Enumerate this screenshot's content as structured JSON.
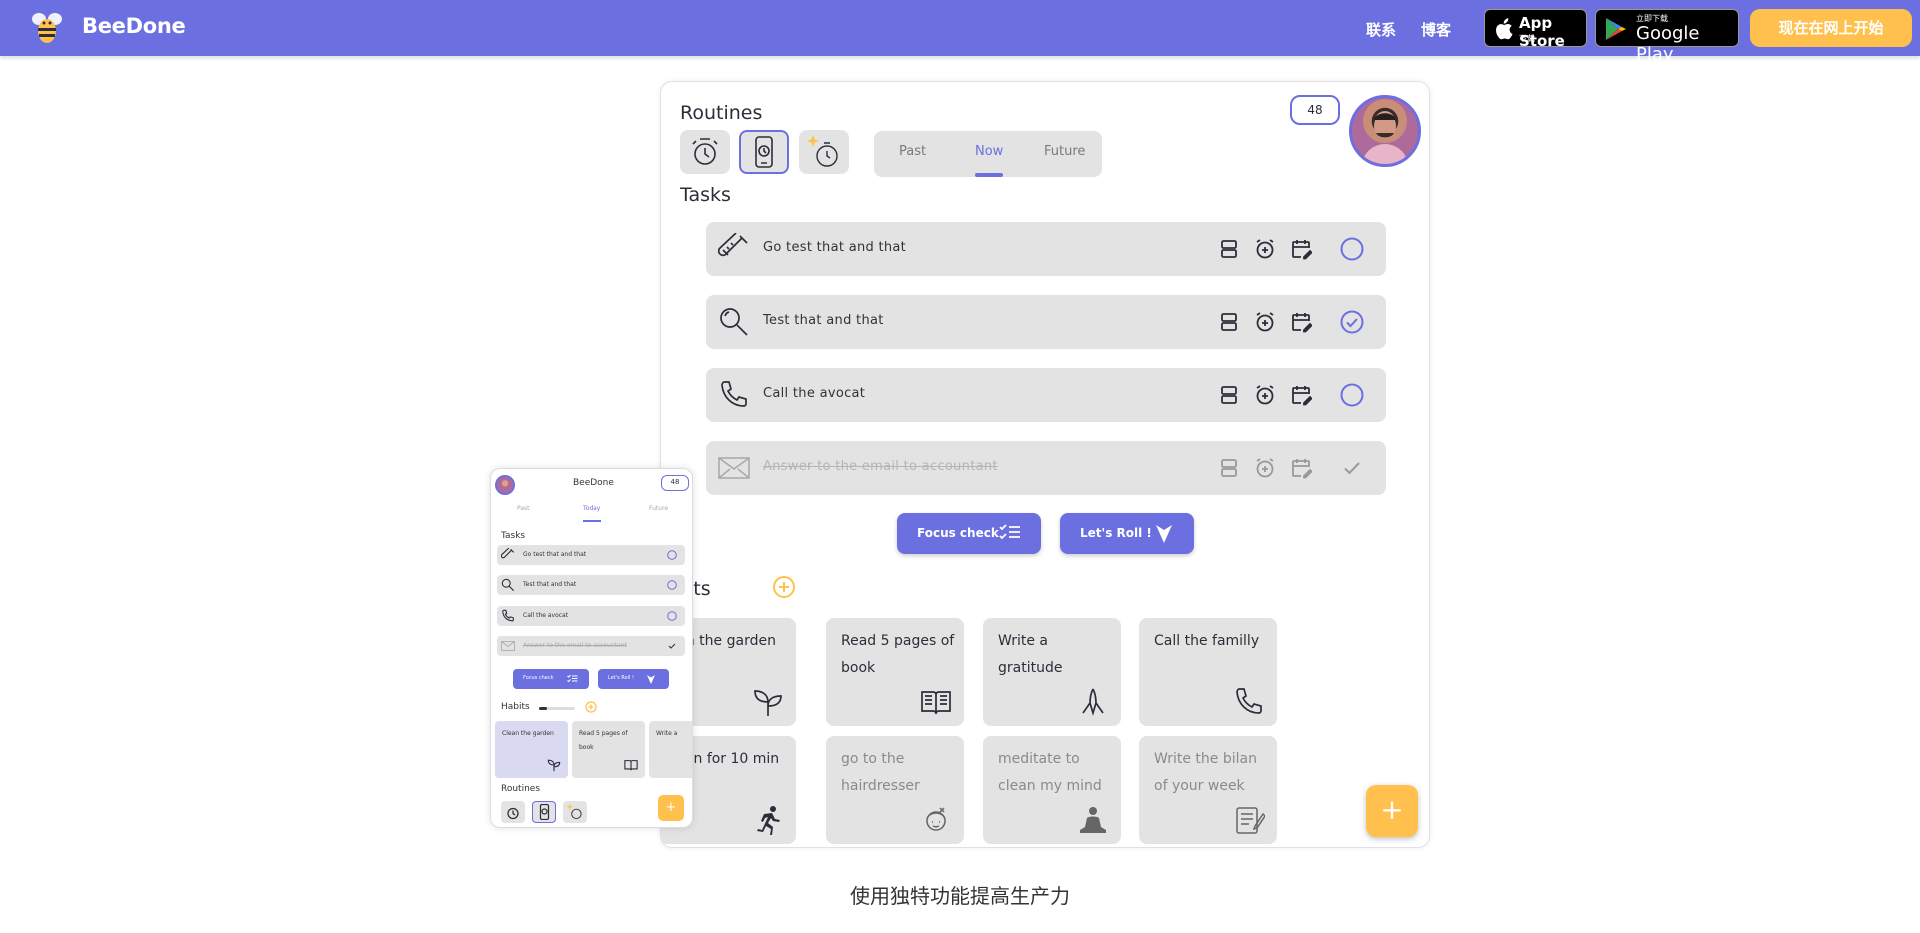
{
  "nav": {
    "brand": "BeeDone",
    "links": [
      "联系",
      "博客"
    ],
    "app_store": {
      "small": "下载",
      "big": "App Store"
    },
    "google_play": {
      "small": "立即下载",
      "big": "Google Play"
    },
    "cta": "现在在网上开始"
  },
  "app": {
    "routines_title": "Routines",
    "segments": [
      "Past",
      "Now",
      "Future"
    ],
    "active_segment": "Now",
    "score": "48",
    "tasks_title": "Tasks",
    "tasks": [
      {
        "label": "Go test that and that",
        "icon": "test-tube-icon",
        "state": "open"
      },
      {
        "label": "Test that and that",
        "icon": "magnifier-icon",
        "state": "checked"
      },
      {
        "label": "Call the avocat",
        "icon": "phone-icon",
        "state": "open"
      },
      {
        "label": "Answer to the email to accountant",
        "icon": "envelope-icon",
        "state": "done"
      }
    ],
    "focus_check": "Focus check",
    "lets_roll": "Let's Roll !",
    "habits_title": "Habits",
    "habits": [
      {
        "label": "Clean the garden",
        "icon": "sprout-icon",
        "muted": false
      },
      {
        "label": "Read 5 pages of book",
        "icon": "book-icon",
        "muted": false
      },
      {
        "label": "Write a gratitude",
        "icon": "praying-hands-icon",
        "muted": false
      },
      {
        "label": "Call the familly",
        "icon": "phone-icon",
        "muted": false
      },
      {
        "label": "Go run for 10 min",
        "icon": "runner-icon",
        "muted": false
      },
      {
        "label": "go to the hairdresser",
        "icon": "hairdresser-icon",
        "muted": true
      },
      {
        "label": "meditate to clean my mind",
        "icon": "meditation-icon",
        "muted": true
      },
      {
        "label": "Write the bilan of your week",
        "icon": "notepad-icon",
        "muted": true
      }
    ],
    "fab": "+"
  },
  "phone": {
    "title": "BeeDone",
    "score": "48",
    "segments": [
      "Past",
      "Today",
      "Future"
    ],
    "tasks_title": "Tasks",
    "tasks": [
      "Go test that and that",
      "Test that and that",
      "Call the avocat",
      "Answer to the email to accountant"
    ],
    "focus_check": "Focus check",
    "lets_roll": "Let's Roll !",
    "habits_title": "Habits",
    "habits": [
      "Clean the garden",
      "Read 5 pages of book",
      "Write a"
    ],
    "routines_title": "Routines",
    "fab": "+"
  },
  "caption": "使用独特功能提高生产力",
  "colors": {
    "brand": "#6B6FE0",
    "accent": "#FFC04D",
    "tile": "#e3e3e3"
  }
}
